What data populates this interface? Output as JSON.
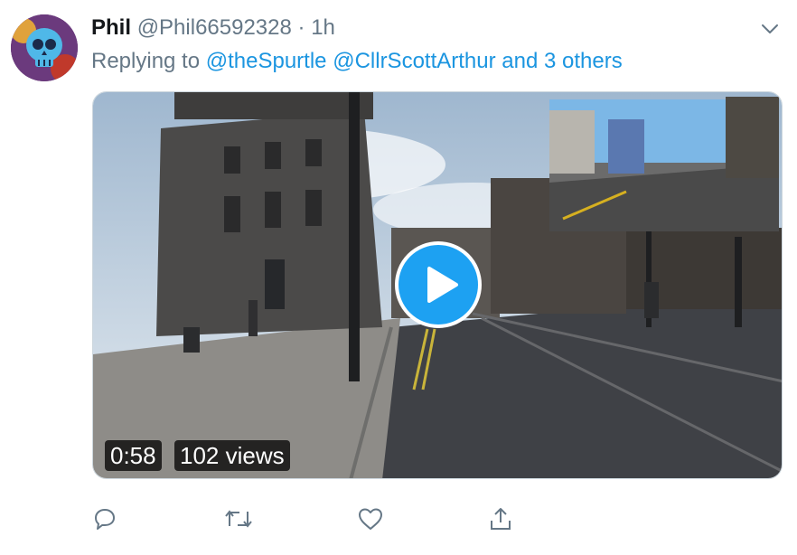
{
  "tweet": {
    "display_name": "Phil",
    "handle": "@Phil66592328",
    "separator": "·",
    "time": "1h",
    "replying_prefix": "Replying to",
    "reply_mentions": [
      "@theSpurtle",
      "@CllrScottArthur"
    ],
    "reply_others": "and 3 others"
  },
  "video": {
    "duration": "0:58",
    "views": "102 views"
  },
  "actions": [
    {
      "name": "reply-icon"
    },
    {
      "name": "retweet-icon"
    },
    {
      "name": "like-icon"
    },
    {
      "name": "share-icon"
    }
  ],
  "colors": {
    "accent": "#1da1f2",
    "link": "#1b95e0",
    "text": "#14171a",
    "muted": "#657786"
  }
}
